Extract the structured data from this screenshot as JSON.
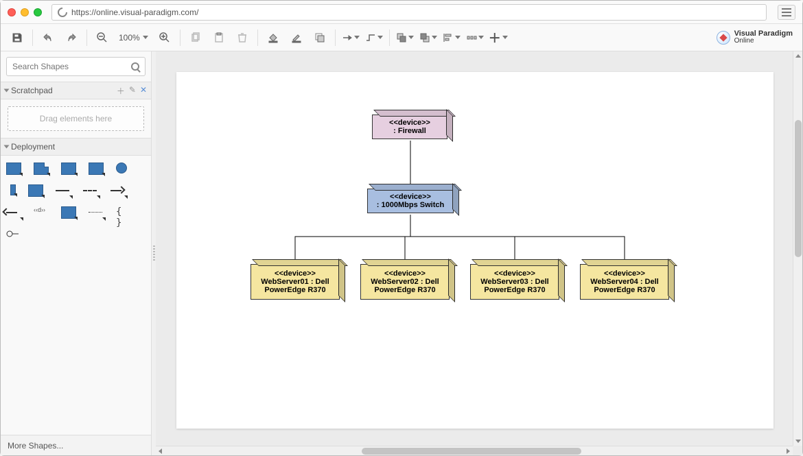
{
  "browser": {
    "url": "https://online.visual-paradigm.com/"
  },
  "toolbar": {
    "zoom": "100%"
  },
  "logo": {
    "line1": "Visual Paradigm",
    "line2": "Online"
  },
  "sidebar": {
    "search_placeholder": "Search Shapes",
    "scratchpad_title": "Scratchpad",
    "drag_hint": "Drag elements here",
    "deployment_title": "Deployment",
    "more_shapes": "More Shapes..."
  },
  "diagram": {
    "firewall": {
      "stereotype": "<<device>>",
      "label": ": Firewall"
    },
    "switch": {
      "stereotype": "<<device>>",
      "label": ": 1000Mbps Switch"
    },
    "servers": [
      {
        "stereotype": "<<device>>",
        "label1": "WebServer01 : Dell",
        "label2": "PowerEdge R370"
      },
      {
        "stereotype": "<<device>>",
        "label1": "WebServer02 : Dell",
        "label2": "PowerEdge R370"
      },
      {
        "stereotype": "<<device>>",
        "label1": "WebServer03 : Dell",
        "label2": "PowerEdge R370"
      },
      {
        "stereotype": "<<device>>",
        "label1": "WebServer04 : Dell",
        "label2": "PowerEdge R370"
      }
    ]
  },
  "chart_data": {
    "type": "diagram",
    "diagram_type": "UML Deployment Diagram",
    "nodes": [
      {
        "id": "firewall",
        "stereotype": "device",
        "name": ": Firewall",
        "color": "#e6cfe0"
      },
      {
        "id": "switch",
        "stereotype": "device",
        "name": ": 1000Mbps Switch",
        "color": "#a8bee0"
      },
      {
        "id": "ws1",
        "stereotype": "device",
        "name": "WebServer01 : Dell PowerEdge R370",
        "color": "#f5e6a0"
      },
      {
        "id": "ws2",
        "stereotype": "device",
        "name": "WebServer02 : Dell PowerEdge R370",
        "color": "#f5e6a0"
      },
      {
        "id": "ws3",
        "stereotype": "device",
        "name": "WebServer03 : Dell PowerEdge R370",
        "color": "#f5e6a0"
      },
      {
        "id": "ws4",
        "stereotype": "device",
        "name": "WebServer04 : Dell PowerEdge R370",
        "color": "#f5e6a0"
      }
    ],
    "edges": [
      {
        "from": "firewall",
        "to": "switch"
      },
      {
        "from": "switch",
        "to": "ws1"
      },
      {
        "from": "switch",
        "to": "ws2"
      },
      {
        "from": "switch",
        "to": "ws3"
      },
      {
        "from": "switch",
        "to": "ws4"
      }
    ]
  }
}
